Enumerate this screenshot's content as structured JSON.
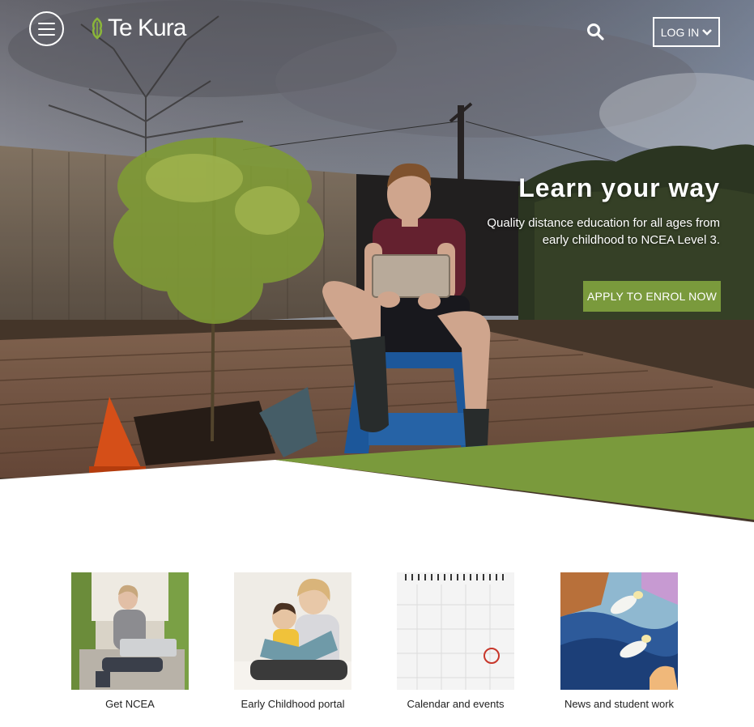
{
  "header": {
    "logo_text": "Te Kura",
    "menu_icon": "hamburger-icon",
    "search_icon": "search-icon",
    "login_label": "LOG IN"
  },
  "hero": {
    "title": "Learn your way",
    "subtitle": "Quality distance education for all ages from early childhood to NCEA Level 3.",
    "cta_label": "APPLY TO ENROL NOW"
  },
  "tiles": [
    {
      "label": "Get NCEA"
    },
    {
      "label": "Early Childhood portal"
    },
    {
      "label": "Calendar and events"
    },
    {
      "label": "News and student work"
    }
  ],
  "colors": {
    "brand_green": "#7a9a3c",
    "text_dark": "#222222",
    "white": "#ffffff"
  }
}
